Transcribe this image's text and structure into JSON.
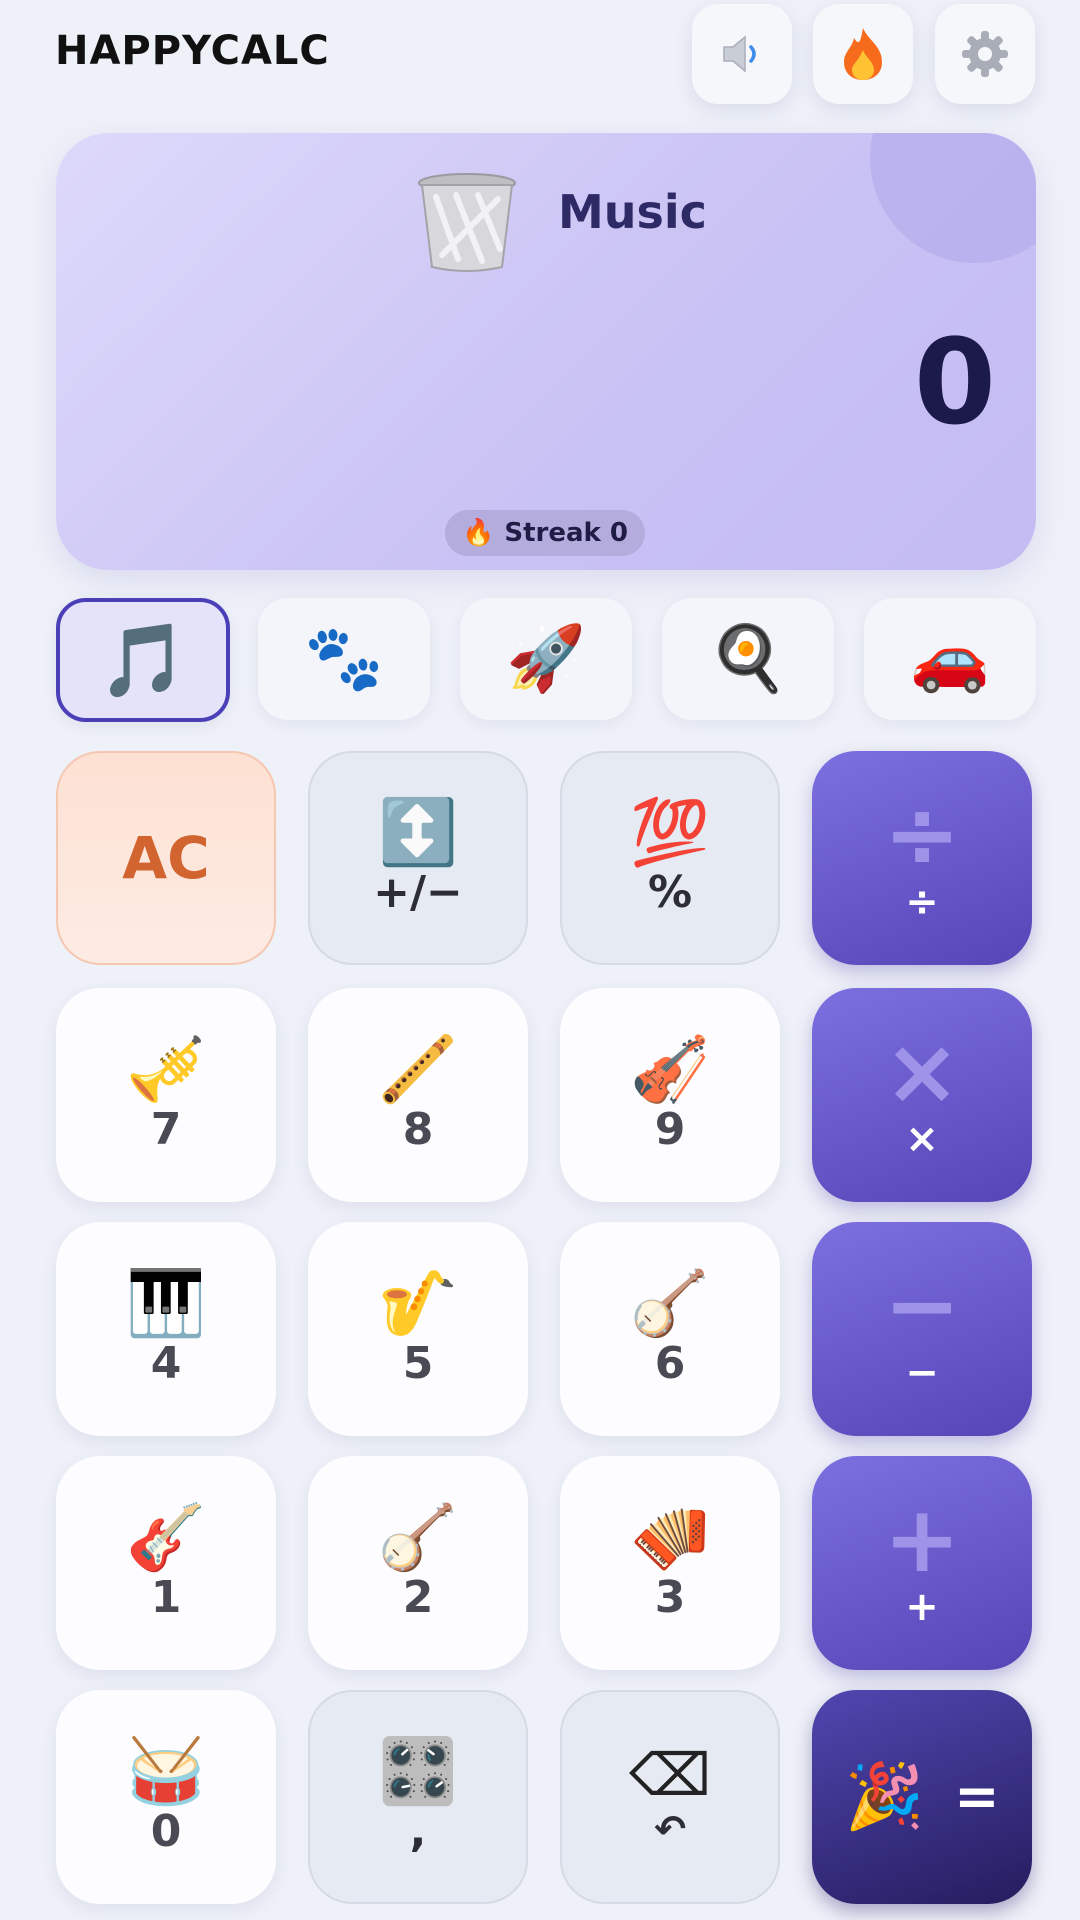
{
  "app": {
    "title": "HAPPYCALC"
  },
  "header_icons": {
    "sound": "speaker-icon",
    "streak": "fire-icon",
    "settings": "gear-icon"
  },
  "display": {
    "theme_name": "Music",
    "theme_icon": "wastebasket-icon",
    "value": "0",
    "streak_label": "Streak 0"
  },
  "themes": [
    {
      "id": "music",
      "emoji": "🎵",
      "active": true
    },
    {
      "id": "animals",
      "emoji": "🐾",
      "active": false
    },
    {
      "id": "space",
      "emoji": "🚀",
      "active": false
    },
    {
      "id": "food",
      "emoji": "🍳",
      "active": false
    },
    {
      "id": "vehicles",
      "emoji": "🚗",
      "active": false
    }
  ],
  "keys": {
    "clear": {
      "label": "AC"
    },
    "sign": {
      "emoji": "↕️",
      "label": "+/−"
    },
    "percent": {
      "emoji": "💯",
      "label": "%"
    },
    "divide": {
      "glyph": "÷",
      "label": "÷"
    },
    "multiply": {
      "glyph": "×",
      "label": "×"
    },
    "subtract": {
      "glyph": "−",
      "label": "−"
    },
    "add": {
      "glyph": "+",
      "label": "+"
    },
    "equals": {
      "emoji": "🎉",
      "label": "="
    },
    "d7": {
      "emoji": "🎺",
      "label": "7"
    },
    "d8": {
      "emoji": "🪈",
      "label": "8"
    },
    "d9": {
      "emoji": "🎻",
      "label": "9"
    },
    "d4": {
      "emoji": "🎹",
      "label": "4"
    },
    "d5": {
      "emoji": "🎷",
      "label": "5"
    },
    "d6": {
      "emoji": "🪕",
      "label": "6"
    },
    "d1": {
      "emoji": "🎸",
      "label": "1"
    },
    "d2": {
      "emoji": "🪕",
      "label": "2"
    },
    "d3": {
      "emoji": "🪗",
      "label": "3"
    },
    "d0": {
      "emoji": "🥁",
      "label": "0"
    },
    "decimal": {
      "emoji": "🎛️",
      "label": ","
    },
    "backspace": {
      "glyph": "⌫",
      "label": "↶"
    }
  },
  "colors": {
    "accent": "#5546b7",
    "clear_text": "#d2642f",
    "display_bg": "#cac3f4"
  }
}
